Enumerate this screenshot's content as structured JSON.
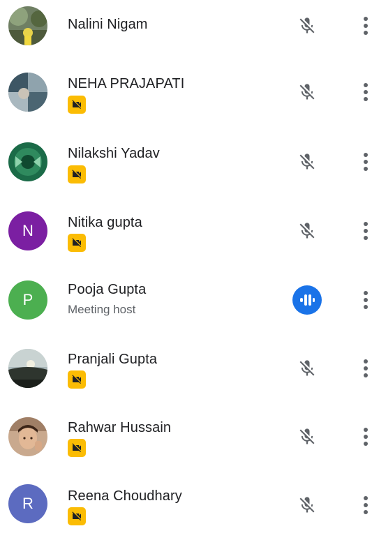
{
  "colors": {
    "badge": "#fbbc04",
    "speaking": "#1a73e8",
    "text": "#202124",
    "secondary": "#5f6368",
    "icon": "#5f6368"
  },
  "participants": [
    {
      "name": "Nalini Nigam",
      "avatar": "photo",
      "status_icon": "mic-off-icon",
      "has_badge": false
    },
    {
      "name": "NEHA PRAJAPATI",
      "avatar": "photo",
      "status_icon": "mic-off-icon",
      "has_badge": true,
      "badge_icon": "camera-off-icon"
    },
    {
      "name": "Nilakshi Yadav",
      "avatar": "photo",
      "status_icon": "mic-off-icon",
      "has_badge": true,
      "badge_icon": "camera-off-icon"
    },
    {
      "name": "Nitika gupta",
      "avatar_letter": "N",
      "avatar_color": "#7b1fa2",
      "status_icon": "mic-off-icon",
      "has_badge": true,
      "badge_icon": "camera-off-icon"
    },
    {
      "name": "Pooja Gupta",
      "subtitle": "Meeting host",
      "avatar_letter": "P",
      "avatar_color": "#4caf50",
      "status_icon": "speaking-icon",
      "has_badge": false
    },
    {
      "name": "Pranjali Gupta",
      "avatar": "photo",
      "status_icon": "mic-off-icon",
      "has_badge": true,
      "badge_icon": "camera-off-icon"
    },
    {
      "name": "Rahwar Hussain",
      "avatar": "photo",
      "status_icon": "mic-off-icon",
      "has_badge": true,
      "badge_icon": "camera-off-icon"
    },
    {
      "name": "Reena Choudhary",
      "avatar_letter": "R",
      "avatar_color": "#5c6bc0",
      "status_icon": "mic-off-icon",
      "has_badge": true,
      "badge_icon": "camera-off-icon"
    }
  ],
  "more_icon": "more-vert-icon"
}
